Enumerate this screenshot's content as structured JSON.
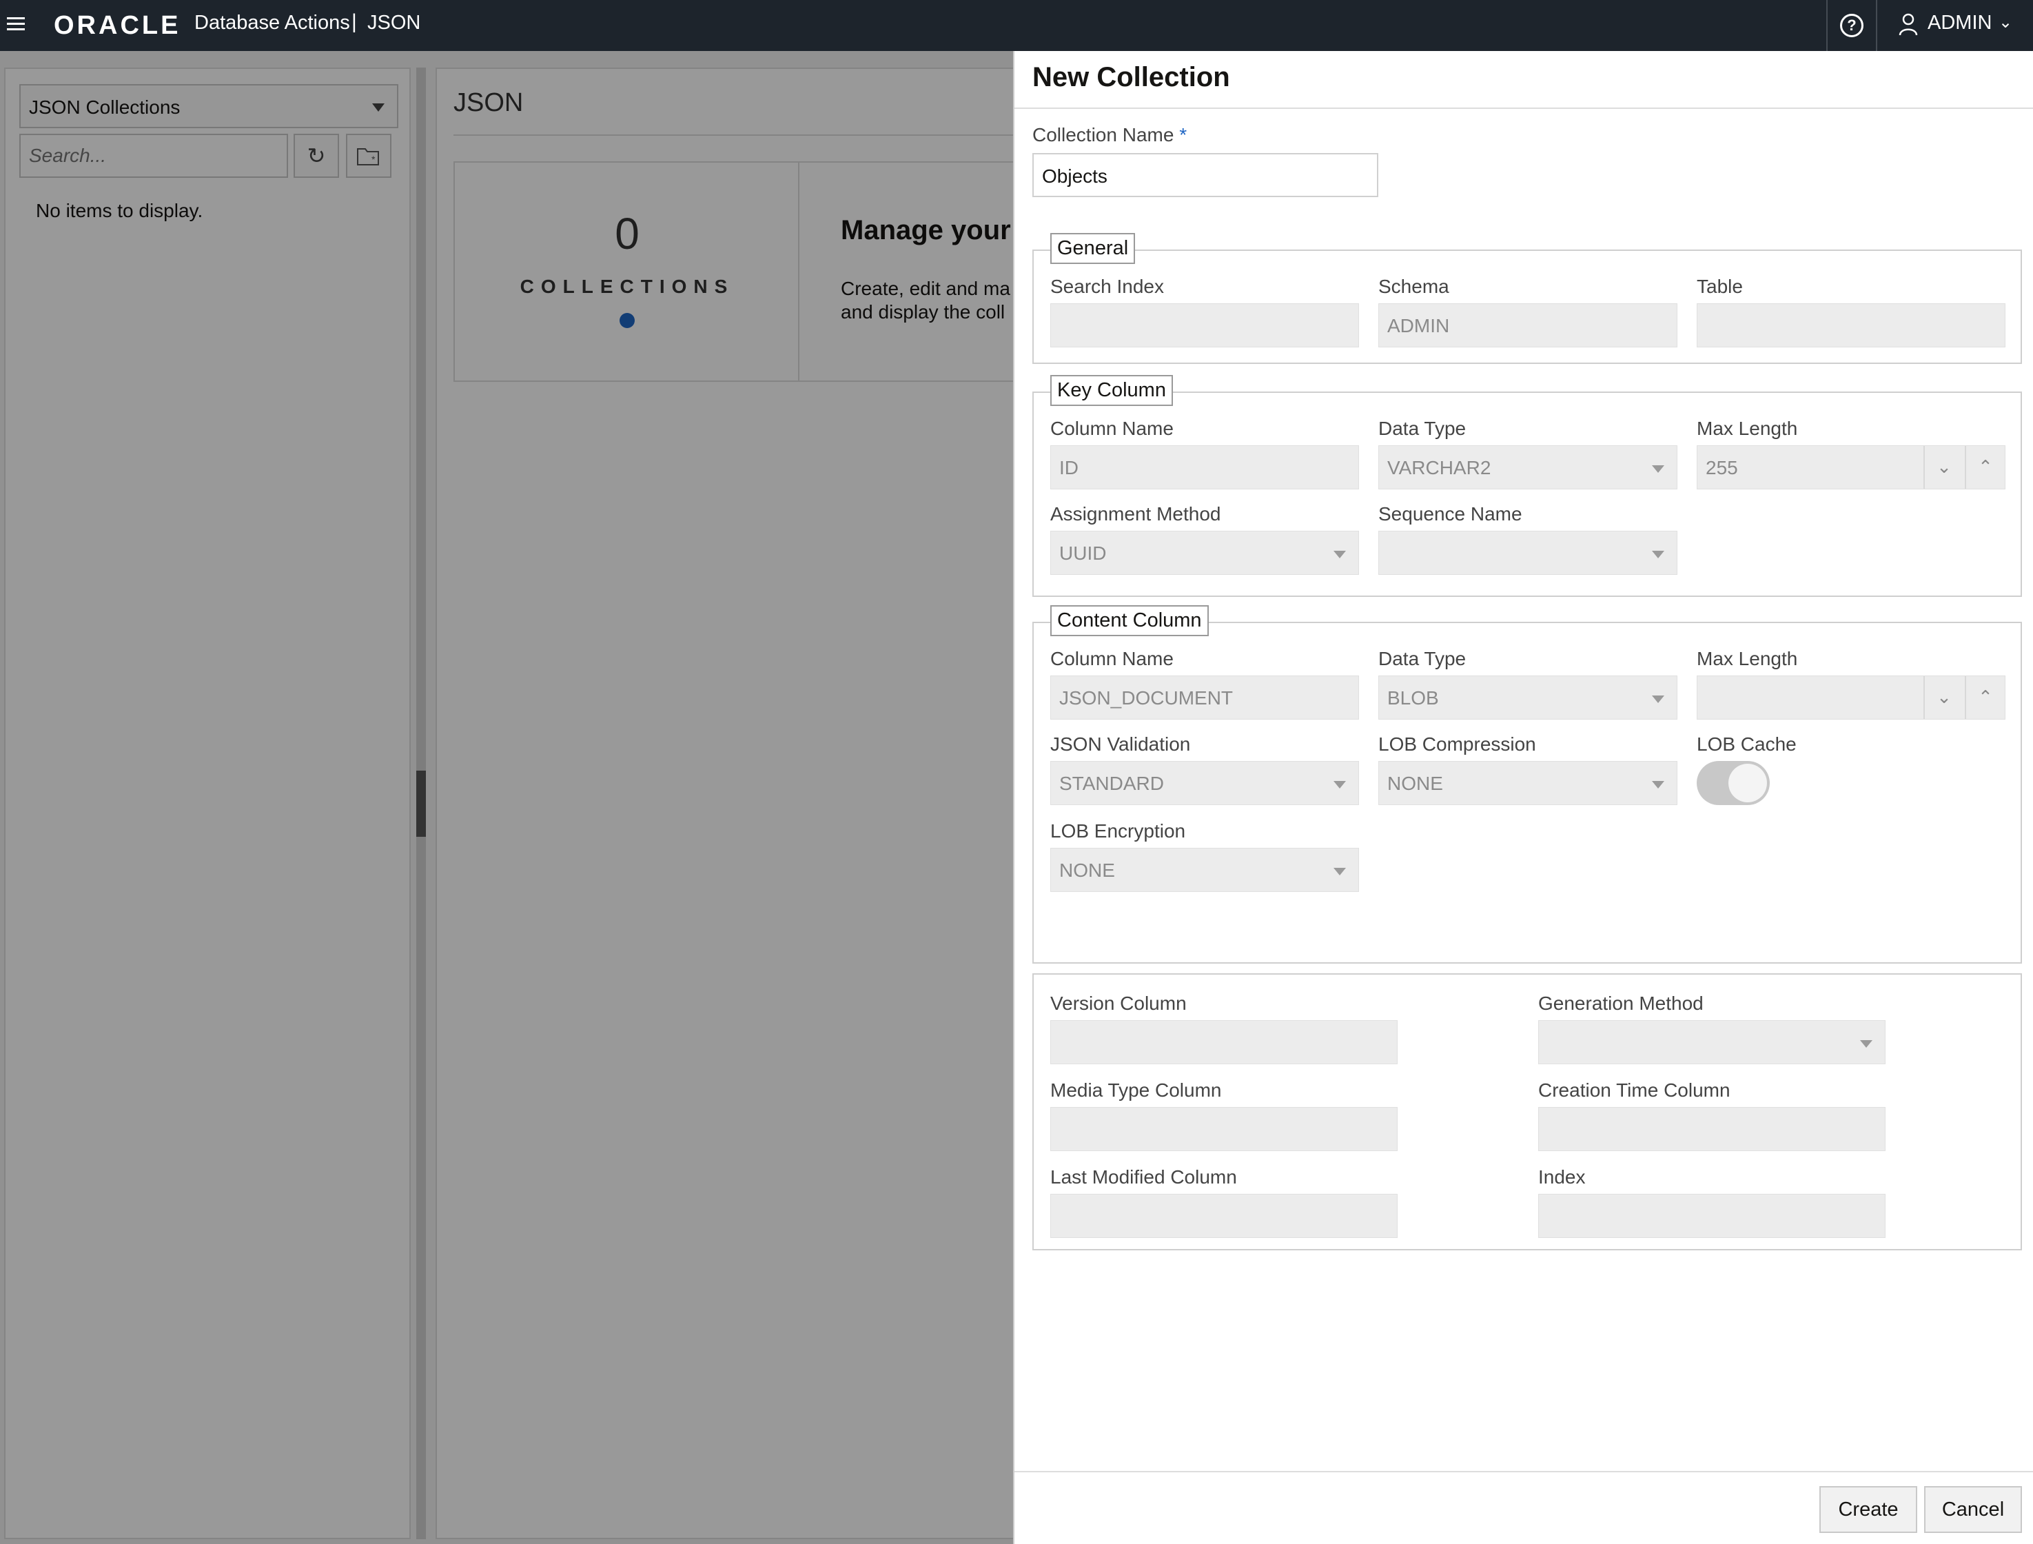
{
  "topbar": {
    "logo": "ORACLE",
    "app_title": "Database Actions",
    "separator": "|",
    "section": "JSON",
    "user": "ADMIN"
  },
  "left_panel": {
    "collection_select": "JSON Collections",
    "search_placeholder": "Search...",
    "empty_message": "No items to display."
  },
  "main": {
    "title": "JSON",
    "collections_count": "0",
    "collections_label": "COLLECTIONS",
    "heading": "Manage your ",
    "description_line1": "Create, edit and ma",
    "description_line2": "and display the coll"
  },
  "drawer": {
    "title": "New Collection",
    "collection_name_label": "Collection Name",
    "required_mark": "*",
    "collection_name_value": "Objects",
    "general": {
      "legend": "General",
      "search_index_label": "Search Index",
      "search_index_value": "",
      "schema_label": "Schema",
      "schema_value": "ADMIN",
      "table_label": "Table",
      "table_value": ""
    },
    "key_column": {
      "legend": "Key Column",
      "column_name_label": "Column Name",
      "column_name_value": "ID",
      "data_type_label": "Data Type",
      "data_type_value": "VARCHAR2",
      "max_length_label": "Max Length",
      "max_length_value": "255",
      "assignment_method_label": "Assignment Method",
      "assignment_method_value": "UUID",
      "sequence_name_label": "Sequence Name",
      "sequence_name_value": ""
    },
    "content_column": {
      "legend": "Content Column",
      "column_name_label": "Column Name",
      "column_name_value": "JSON_DOCUMENT",
      "data_type_label": "Data Type",
      "data_type_value": "BLOB",
      "max_length_label": "Max Length",
      "max_length_value": "",
      "json_validation_label": "JSON Validation",
      "json_validation_value": "STANDARD",
      "lob_compression_label": "LOB Compression",
      "lob_compression_value": "NONE",
      "lob_cache_label": "LOB Cache",
      "lob_encryption_label": "LOB Encryption",
      "lob_encryption_value": "NONE"
    },
    "other": {
      "version_column_label": "Version Column",
      "generation_method_label": "Generation Method",
      "media_type_column_label": "Media Type Column",
      "creation_time_column_label": "Creation Time Column",
      "last_modified_column_label": "Last Modified Column",
      "index_label": "Index"
    },
    "buttons": {
      "create": "Create",
      "cancel": "Cancel"
    }
  }
}
